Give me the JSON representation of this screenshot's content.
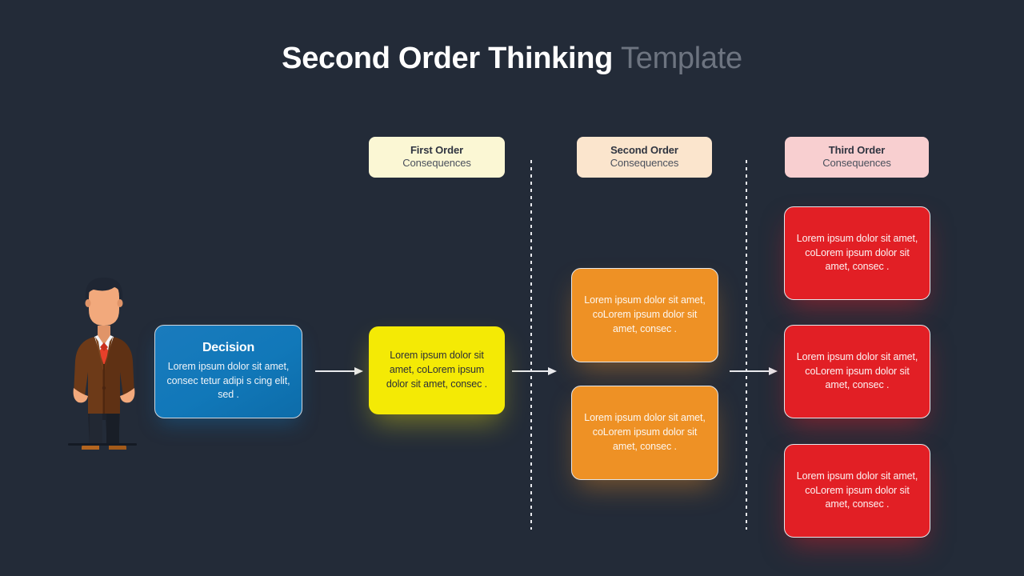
{
  "title": {
    "main": "Second Order Thinking",
    "sub": "Template"
  },
  "headers": [
    {
      "name": "first-order",
      "title": "First Order",
      "subtitle": "Consequences",
      "color": "#fbf7d4"
    },
    {
      "name": "second-order",
      "title": "Second Order",
      "subtitle": "Consequences",
      "color": "#fbe5cd"
    },
    {
      "name": "third-order",
      "title": "Third Order",
      "subtitle": "Consequences",
      "color": "#f8cfd0"
    }
  ],
  "decision": {
    "title": "Decision",
    "text": "Lorem ipsum dolor sit amet, consec tetur adipi s cing elit, sed .",
    "color": "#1178b9"
  },
  "first_order": {
    "color": "#f4ea05",
    "cards": [
      {
        "text": "Lorem ipsum dolor sit amet, coLorem ipsum dolor sit amet, consec ."
      }
    ]
  },
  "second_order": {
    "color": "#ee9125",
    "cards": [
      {
        "text": "Lorem ipsum dolor sit amet, coLorem ipsum dolor sit amet, consec ."
      },
      {
        "text": "Lorem ipsum dolor sit amet, coLorem ipsum dolor sit amet, consec ."
      }
    ]
  },
  "third_order": {
    "color": "#e21f25",
    "cards": [
      {
        "text": "Lorem ipsum dolor sit amet, coLorem ipsum dolor sit amet, consec ."
      },
      {
        "text": "Lorem ipsum dolor sit amet, coLorem ipsum dolor sit amet, consec ."
      },
      {
        "text": "Lorem ipsum dolor sit amet, coLorem ipsum dolor sit amet, consec ."
      }
    ]
  },
  "illustration": {
    "name": "businessman-illustration",
    "hair": "#1f2633",
    "skin": "#f2a97c",
    "suit": "#6d3a18",
    "suit_dark": "#5a2f13",
    "shirt": "#f4f5f7",
    "tie": "#e8402a",
    "trousers": "#1d222c",
    "shoes": "#b4651f"
  },
  "background": "#232b38",
  "connector_color": "#e9eaee"
}
